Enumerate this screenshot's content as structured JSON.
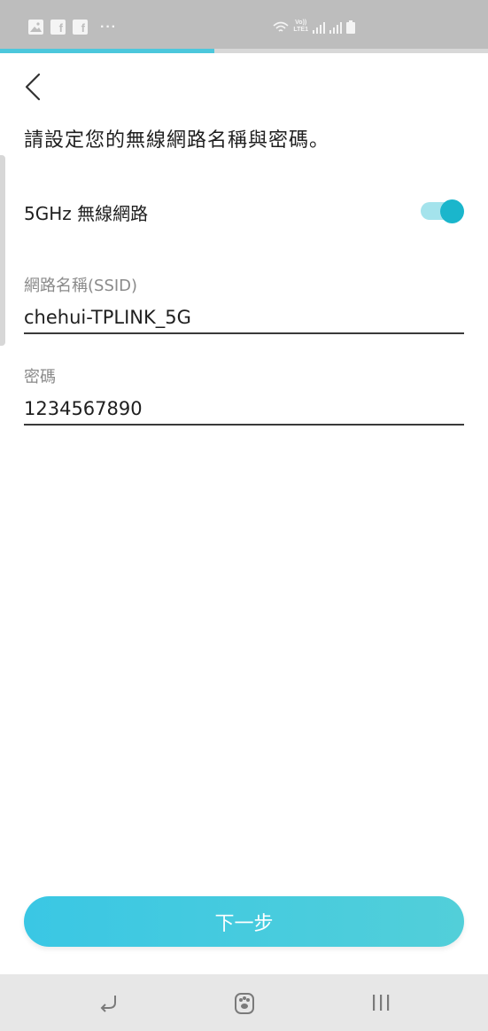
{
  "status_bar": {
    "left_icons": [
      "gallery-icon",
      "facebook-icon",
      "facebook-icon",
      "more-dots-icon"
    ],
    "right_icons": [
      "wifi-icon",
      "volte-icon",
      "signal-icon",
      "signal-icon",
      "battery-icon"
    ],
    "fb_letter": "f",
    "dots": "···",
    "volte_label_top": "Vo))",
    "volte_label_bottom": "LTE1"
  },
  "progress": {
    "fraction": 0.44,
    "color": "#4cc7dc"
  },
  "header": {
    "back_icon": "chevron-left-icon"
  },
  "page": {
    "title": "請設定您的無線網路名稱與密碼。"
  },
  "wireless_5g": {
    "label": "5GHz 無線網路",
    "enabled": true,
    "track_color": "#a4e3ec",
    "knob_color": "#1ab6cc"
  },
  "ssid_field": {
    "label": "網路名稱(SSID)",
    "value": "chehui-TPLINK_5G"
  },
  "password_field": {
    "label": "密碼",
    "value": "1234567890"
  },
  "next_button": {
    "label": "下一步",
    "color": "#3ac7e4"
  },
  "nav_bar": {
    "items": [
      "back-nav-icon",
      "home-nav-icon",
      "recent-apps-icon"
    ]
  }
}
